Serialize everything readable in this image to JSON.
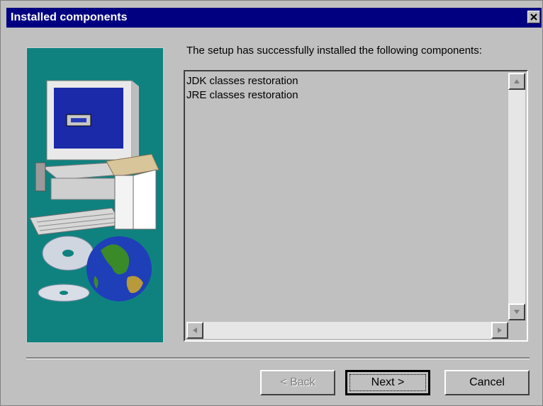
{
  "window": {
    "title": "Installed components"
  },
  "message": "The setup has successfully installed the following components:",
  "components": [
    "JDK classes restoration",
    "JRE classes restoration"
  ],
  "buttons": {
    "back": "< Back",
    "next": "Next >",
    "cancel": "Cancel"
  },
  "colors": {
    "titlebar": "#000080",
    "panel": "#0f8280",
    "face": "#c0c0c0"
  },
  "icons": {
    "close": "close-icon",
    "art": "computer-globe-cd-illustration"
  }
}
